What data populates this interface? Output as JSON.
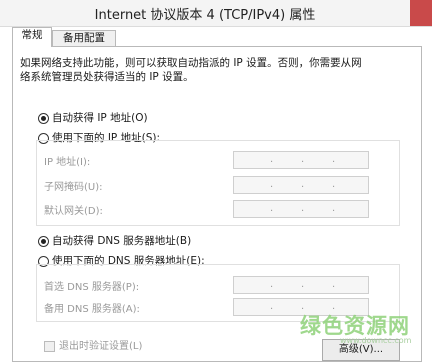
{
  "window": {
    "title": "Internet 协议版本 4 (TCP/IPv4) 属性"
  },
  "tabs": [
    {
      "label": "常规"
    },
    {
      "label": "备用配置"
    }
  ],
  "description": {
    "line1": "如果网络支持此功能，则可以获取自动指派的 IP 设置。否则，你需要从网",
    "line2": "络系统管理员处获得适当的 IP 设置。"
  },
  "ip": {
    "auto_label": "自动获得 IP 地址(O)",
    "manual_label": "使用下面的 IP 地址(S):",
    "fields": [
      {
        "label": "IP 地址(I):",
        "value": ". . ."
      },
      {
        "label": "子网掩码(U):",
        "value": ". . ."
      },
      {
        "label": "默认网关(D):",
        "value": ". . ."
      }
    ]
  },
  "dns": {
    "auto_label": "自动获得 DNS 服务器地址(B)",
    "manual_label": "使用下面的 DNS 服务器地址(E):",
    "fields": [
      {
        "label": "首选 DNS 服务器(P):",
        "value": ". . ."
      },
      {
        "label": "备用 DNS 服务器(A):",
        "value": ". . ."
      }
    ]
  },
  "footer": {
    "validate_label": "退出时验证设置(L)",
    "advanced_label": "高级(V)..."
  },
  "watermark": {
    "text": "绿色资源网",
    "url": "www.downcc.com"
  },
  "colors": {
    "close": "#c94a4a",
    "watermark": "#8fd27a"
  }
}
